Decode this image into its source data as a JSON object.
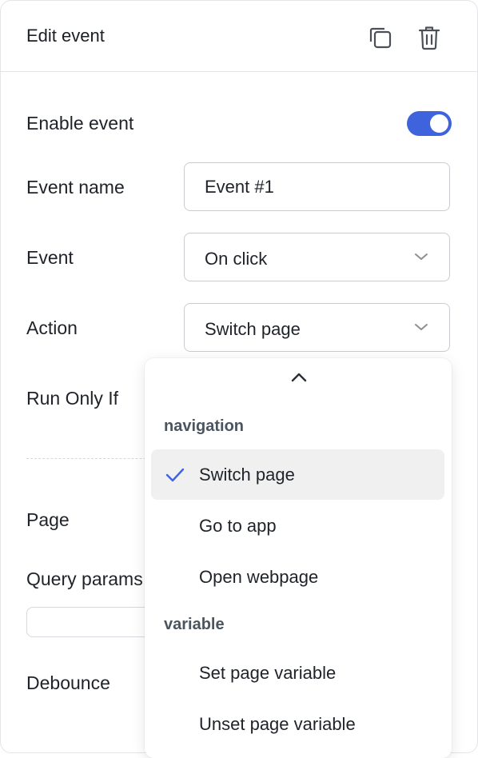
{
  "header": {
    "title": "Edit event",
    "icons": [
      "copy-icon",
      "trash-icon"
    ]
  },
  "form": {
    "enable_event_label": "Enable event",
    "enable_event_value": true,
    "event_name_label": "Event name",
    "event_name_value": "Event #1",
    "event_label": "Event",
    "event_value": "On click",
    "action_label": "Action",
    "action_value": "Switch page",
    "run_only_if_label": "Run Only If",
    "page_label": "Page",
    "query_params_label": "Query params",
    "debounce_label": "Debounce"
  },
  "dropdown": {
    "groups": [
      {
        "label": "navigation",
        "options": [
          {
            "label": "Switch page",
            "selected": true
          },
          {
            "label": "Go to app",
            "selected": false
          },
          {
            "label": "Open webpage",
            "selected": false
          }
        ]
      },
      {
        "label": "variable",
        "options": [
          {
            "label": "Set page variable",
            "selected": false
          },
          {
            "label": "Unset page variable",
            "selected": false
          }
        ]
      }
    ]
  },
  "colors": {
    "accent": "#3e63dd",
    "border": "#c9ccd1",
    "selected_bg": "#f0f0f0",
    "group_label": "#4a5560"
  }
}
